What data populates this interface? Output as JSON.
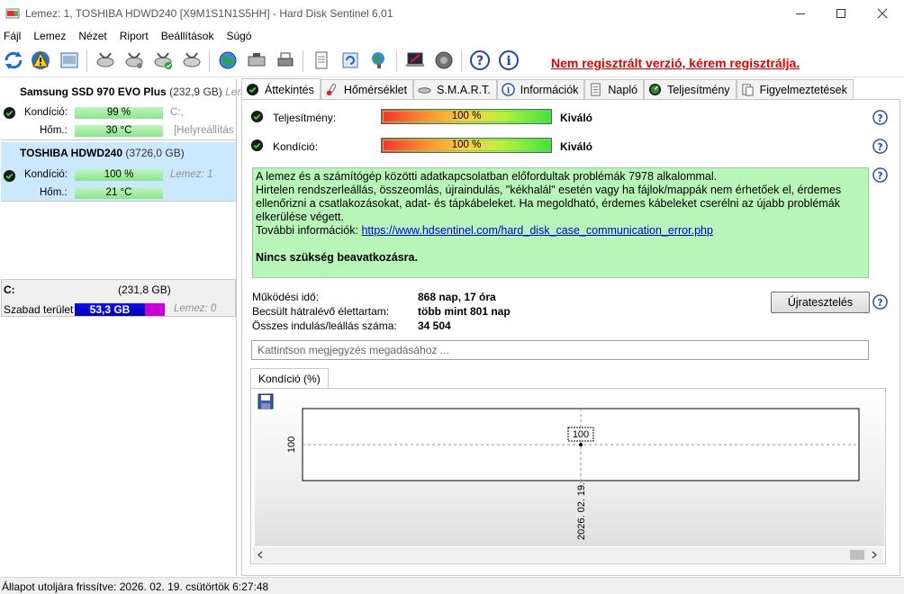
{
  "window": {
    "title": "Lemez: 1, TOSHIBA HDWD240 [X9M1S1N1S5HH]  -  Hard Disk Sentinel 6.01"
  },
  "menu": [
    "Fájl",
    "Lemez",
    "Nézet",
    "Riport",
    "Beállítások",
    "Súgó"
  ],
  "toolbar": {
    "registration": "Nem regisztrált verzió, kérem regisztrálja."
  },
  "disks": [
    {
      "name": "Samsung SSD 970 EVO Plus",
      "size": "(232,9 GB)",
      "extra": "Leme",
      "condition_label": "Kondíció:",
      "condition_value": "99 %",
      "condition_note": "C:,",
      "temp_label": "Hőm.:",
      "temp_value": "30 °C",
      "temp_note": "[Helyreállítás"
    },
    {
      "name": "TOSHIBA HDWD240",
      "size": "(3726,0 GB)",
      "condition_label": "Kondíció:",
      "condition_value": "100 %",
      "condition_note": "Lemez: 1",
      "temp_label": "Hőm.:",
      "temp_value": "21 °C"
    }
  ],
  "volume": {
    "letter": "C:",
    "size": "(231,8 GB)",
    "free_label": "Szabad terület",
    "free_value": "53,3 GB",
    "free_fraction": 0.23,
    "note": "Lemez: 0"
  },
  "tabs": [
    "Áttekintés",
    "Hőmérséklet",
    "S.M.A.R.T.",
    "Információk",
    "Napló",
    "Teljesítmény",
    "Figyelmeztetések"
  ],
  "overview": {
    "performance_label": "Teljesítmény:",
    "performance_value": "100 %",
    "performance_grade": "Kiváló",
    "condition_label": "Kondíció:",
    "condition_value": "100 %",
    "condition_grade": "Kiváló",
    "message_line1": "A lemez és a számítógép közötti adatkapcsolatban előfordultak problémák 7978 alkalommal.",
    "message_line2": "Hirtelen rendszerleállás, összeomlás, újraindulás, \"kékhalál\" esetén vagy ha fájlok/mappák nem érhetőek el, érdemes ellenőrizni a csatlakozásokat, adat- és tápkábeleket. Ha megoldható, érdemes kábeleket cserélni az újabb problémák elkerülése végett.",
    "more_info_label": "További információk:",
    "more_info_link": "https://www.hdsentinel.com/hard_disk_case_communication_error.php",
    "action": "Nincs szükség beavatkozásra.",
    "uptime_label": "Működési idő:",
    "uptime_value": "868 nap, 17 óra",
    "remaining_label": "Becsült hátralévő élettartam:",
    "remaining_value": "több mint 801 nap",
    "starts_label": "Összes indulás/leállás száma:",
    "starts_value": "34 504",
    "retest_button": "Újratesztelés",
    "note_placeholder": "Kattintson megjegyzés megadásához ..."
  },
  "chart_tab": "Kondíció  (%)",
  "chart_data": {
    "type": "line",
    "x": [
      "2026. 02. 19."
    ],
    "series": [
      {
        "values": [
          100
        ]
      }
    ],
    "ylabel": "",
    "xlabel": "",
    "ytick": "100",
    "data_label": "100"
  },
  "status": "Állapot utoljára frissítve: 2026. 02. 19. csütörtök 6:27:48",
  "colors": {
    "selected_disk": "#cce8ff",
    "message_bg": "#b8f5b8",
    "registration": "#e00000"
  }
}
